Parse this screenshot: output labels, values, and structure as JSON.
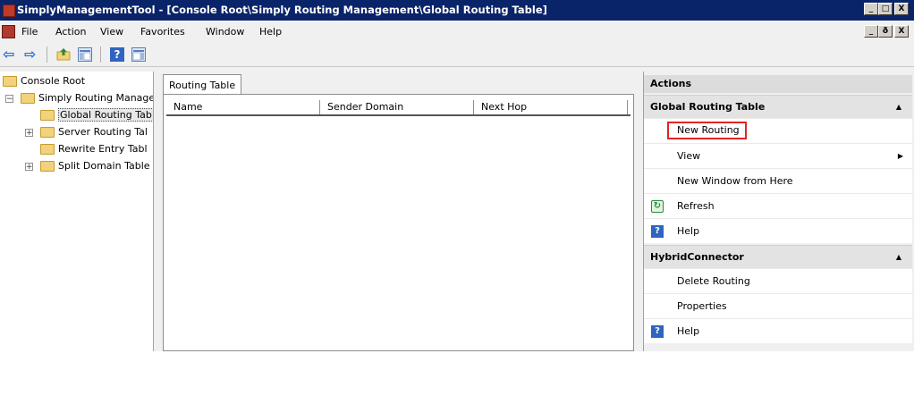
{
  "window": {
    "title": "SimplyManagementTool - [Console Root\\Simply Routing Management\\Global Routing Table]",
    "min_glyph": "_",
    "max_glyph": "□",
    "close_glyph": "X",
    "restore_glyph": "ð"
  },
  "menu": {
    "items": [
      "File",
      "Action",
      "View",
      "Favorites",
      "Window",
      "Help"
    ]
  },
  "toolbar": {
    "back_glyph": "⇦",
    "forward_glyph": "⇨",
    "help_glyph": "?"
  },
  "tree": {
    "root": "Console Root",
    "expander_minus": "−",
    "expander_plus": "+",
    "nodes": [
      "Simply Routing Manage",
      "Global Routing Tab",
      "Server Routing Tal",
      "Rewrite Entry Tabl",
      "Split Domain Table"
    ]
  },
  "center": {
    "tab_label": "Routing Table",
    "columns": [
      "Name",
      "Sender Domain",
      "Next Hop"
    ]
  },
  "actions": {
    "header": "Actions",
    "groups": [
      {
        "title": "Global Routing Table",
        "items": [
          "New Routing",
          "View",
          "New Window from Here",
          "Refresh",
          "Help"
        ]
      },
      {
        "title": "HybridConnector",
        "items": [
          "Delete Routing",
          "Properties",
          "Help"
        ]
      }
    ],
    "collapse_glyph": "▲",
    "submenu_glyph": "▶"
  },
  "colors": {
    "titlebar": "#0a246a",
    "highlight_box": "#e02424"
  }
}
